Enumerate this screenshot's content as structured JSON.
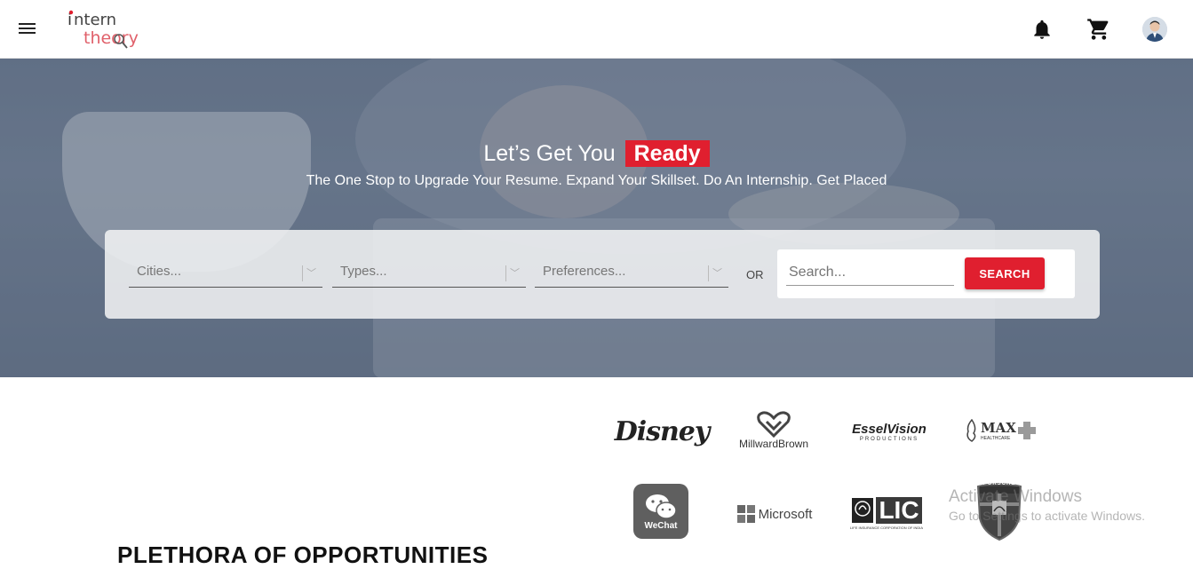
{
  "header": {
    "menu_icon": "hamburger-icon",
    "logo": "intern theory",
    "icons": [
      "bell-icon",
      "cart-icon",
      "avatar"
    ]
  },
  "hero": {
    "title": "Let’s Get You",
    "title_highlight": "Ready",
    "subtitle": "The One Stop to Upgrade Your Resume. Expand Your Skillset. Do An Internship. Get Placed",
    "accent_color": "#e01f2f"
  },
  "search": {
    "cities_placeholder": "Cities...",
    "types_placeholder": "Types...",
    "preferences_placeholder": "Preferences...",
    "or_label": "OR",
    "search_placeholder": "Search...",
    "search_button": "SEARCH"
  },
  "brands": {
    "disney": "Disney",
    "millward_brown": "MillwardBrown",
    "essel_vision": "EsselVision",
    "essel_vision_sub": "PRODUCTIONS",
    "max": "MAX",
    "max_sub": "HEALTHCARE",
    "wechat": "WeChat",
    "microsoft": "Microsoft",
    "lic": "LIC",
    "lic_sub": "LIFE INSURANCE CORPORATION OF INDIA",
    "porsche": "PORSCHE"
  },
  "section": {
    "title": "PLETHORA OF OPPORTUNITIES"
  },
  "watermark": {
    "line1": "Activate Windows",
    "line2": "Go to Settings to activate Windows."
  }
}
